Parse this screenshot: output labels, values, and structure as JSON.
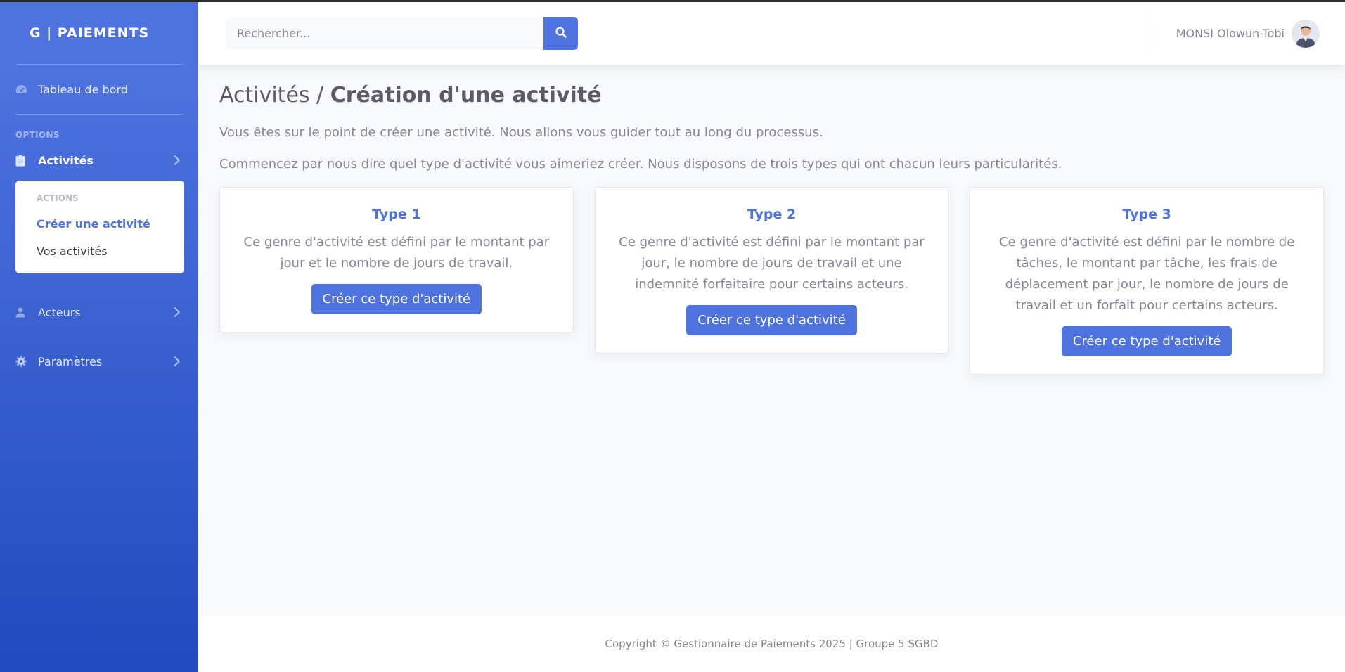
{
  "brand": "G | PAIEMENTS",
  "sidebar": {
    "dashboard": "Tableau de bord",
    "options_heading": "OPTIONS",
    "activities": "Activités",
    "actions_heading": "ACTIONS",
    "create_activity": "Créer une activité",
    "my_activities": "Vos activités",
    "actors": "Acteurs",
    "settings": "Paramètres"
  },
  "search": {
    "placeholder": "Rechercher..."
  },
  "user": {
    "name": "MONSI Olowun-Tobi"
  },
  "page": {
    "breadcrumb_parent": "Activités / ",
    "title": "Création d'une activité",
    "intro1": "Vous êtes sur le point de créer une activité. Nous allons vous guider tout au long du processus.",
    "intro2": "Commencez par nous dire quel type d'activité vous aimeriez créer. Nous disposons de trois types qui ont chacun leurs particularités."
  },
  "cards": [
    {
      "title": "Type 1",
      "text": "Ce genre d'activité est défini par le montant par jour et le nombre de jours de travail.",
      "button": "Créer ce type d'activité"
    },
    {
      "title": "Type 2",
      "text": "Ce genre d'activité est défini par le montant par jour, le nombre de jours de travail et une indemnité forfaitaire pour certains acteurs.",
      "button": "Créer ce type d'activité"
    },
    {
      "title": "Type 3",
      "text": "Ce genre d'activité est défini par le nombre de tâches, le montant par tâche, les frais de déplacement par jour, le nombre de jours de travail et un forfait pour certains acteurs.",
      "button": "Créer ce type d'activité"
    }
  ],
  "footer": "Copyright © Gestionnaire de Paiements 2025 | Groupe 5 SGBD",
  "colors": {
    "primary": "#4e73df",
    "sidebar_gradient_end": "#224abe",
    "text_muted": "#858796"
  },
  "icons": [
    "dashboard-icon",
    "clipboard-icon",
    "user-icon",
    "gear-icon",
    "search-icon",
    "chevron-right-icon"
  ]
}
